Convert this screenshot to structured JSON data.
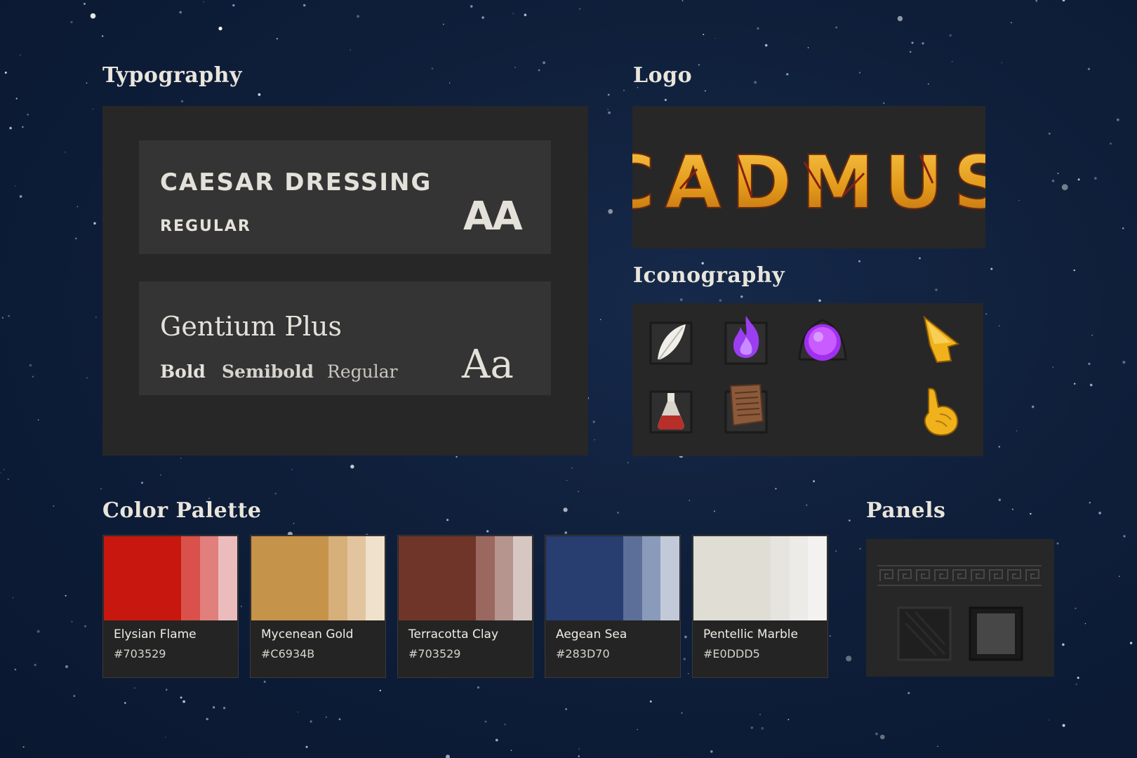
{
  "sections": {
    "typography": "Typography",
    "logo": "Logo",
    "iconography": "Iconography",
    "palette": "Color Palette",
    "panels": "Panels"
  },
  "typography": {
    "display_font": {
      "name": "Caesar Dressing",
      "weight": "Regular",
      "sample": "AA"
    },
    "body_font": {
      "name": "Gentium Plus",
      "weights": [
        "Bold",
        "Semibold",
        "Regular"
      ],
      "sample": "Aa"
    }
  },
  "logo": {
    "text": "CADMUS",
    "colors": {
      "gold": "#e8a21e",
      "crack": "#8a1f10"
    }
  },
  "iconography": {
    "icons": [
      "feather-icon",
      "flame-icon",
      "orb-icon",
      "cursor-arrow-icon",
      "potion-icon",
      "scroll-tablet-icon",
      "pointing-hand-icon"
    ]
  },
  "palette": [
    {
      "name": "Elysian Flame",
      "hex": "#703529",
      "shades": [
        "#c8170f",
        "#d9514a",
        "#e07f7c",
        "#ecbcbd"
      ]
    },
    {
      "name": "Mycenean Gold",
      "hex": "#C6934B",
      "shades": [
        "#c6934b",
        "#d7af7a",
        "#e2c59e",
        "#efe1cb"
      ]
    },
    {
      "name": "Terracotta Clay",
      "hex": "#703529",
      "shades": [
        "#703529",
        "#9b6860",
        "#b7958f",
        "#d7c7c3"
      ]
    },
    {
      "name": "Aegean Sea",
      "hex": "#283D70",
      "shades": [
        "#283d70",
        "#5c6f98",
        "#8a9aba",
        "#c2cada"
      ]
    },
    {
      "name": "Pentellic Marble",
      "hex": "#E0DDD5",
      "shades": [
        "#e0ddd5",
        "#e6e4de",
        "#ecebe7",
        "#f3f2f0"
      ]
    }
  ],
  "panels": {
    "tiles": [
      "panel-tile-dark",
      "panel-tile-light"
    ]
  }
}
